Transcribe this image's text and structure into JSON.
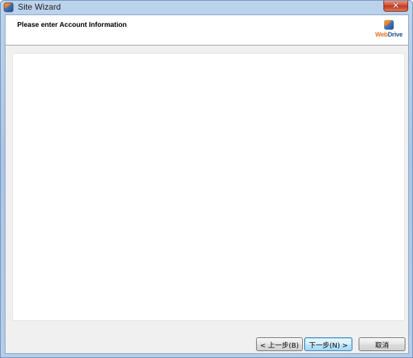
{
  "window": {
    "title": "Site Wizard",
    "close_symbol": "✕",
    "icon": "webdrive-app-icon"
  },
  "header": {
    "title": "Please enter Account Information",
    "logo": {
      "part1": "Web",
      "part2": "Drive",
      "icon": "webdrive-logo-icon"
    }
  },
  "buttons": {
    "back_label": "< 上一步(B)",
    "next_label": "下一步(N) >",
    "cancel_label": "取消"
  },
  "colors": {
    "logo_orange": "#e2731f",
    "logo_blue": "#1f4f8f",
    "default_button_border": "#3c7fb1"
  }
}
